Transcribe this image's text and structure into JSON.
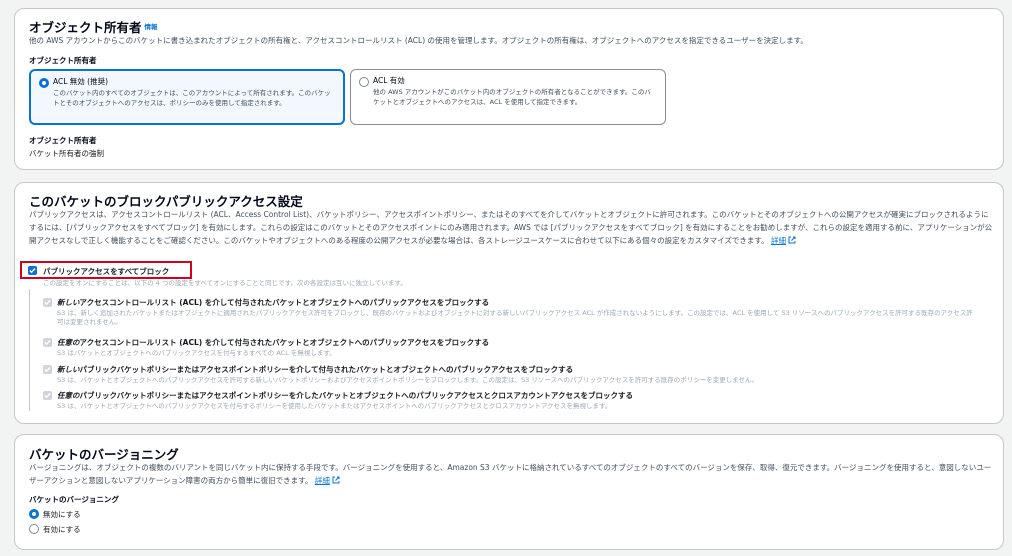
{
  "owner": {
    "title": "オブジェクト所有者",
    "info": "情報",
    "desc": "他の AWS アカウントからこのバケットに書き込まれたオブジェクトの所有権と、アクセスコントロールリスト (ACL) の使用を管理します。オブジェクトの所有権は、オブジェクトへのアクセスを指定できるユーザーを決定します。",
    "field_label": "オブジェクト所有者",
    "options": [
      {
        "title": "ACL 無効 (推奨)",
        "desc": "このバケット内のすべてのオブジェクトは、このアカウントによって所有されます。このバケットとそのオブジェクトへのアクセスは、ポリシーのみを使用して指定されます。"
      },
      {
        "title": "ACL 有効",
        "desc": "他の AWS アカウントがこのバケット内のオブジェクトの所有者となることができます。このバケットとオブジェクトへのアクセスは、ACL を使用して指定できます。"
      }
    ],
    "result_label": "オブジェクト所有者",
    "result_value": "バケット所有者の強制"
  },
  "block": {
    "title": "このバケットのブロックパブリックアクセス設定",
    "desc": "パブリックアクセスは、アクセスコントロールリスト (ACL、Access Control List)、バケットポリシー、アクセスポイントポリシー、またはそのすべてを介してバケットとオブジェクトに許可されます。このバケットとそのオブジェクトへの公開アクセスが確実にブロックされるようにするには、[パブリックアクセスをすべてブロック] を有効にします。これらの設定はこのバケットとそのアクセスポイントにのみ適用されます。AWS では [パブリックアクセスをすべてブロック] を有効にすることをお勧めしますが、これらの設定を適用する前に、アプリケーションが公開アクセスなしで正しく機能することをご確認ください。このバケットやオブジェクトへのある程度の公開アクセスが必要な場合は、各ストレージユースケースに合わせて以下にある個々の設定をカスタマイズできます。",
    "more_link": "詳細",
    "master_label": "パブリックアクセスをすべてブロック",
    "master_desc": "この設定をオンにすることは、以下の 4 つの設定をすべてオンにすることと同じです。次の各設定は互いに独立しています。",
    "items": [
      {
        "title_em": "新しい",
        "title_rest": "アクセスコントロールリスト (ACL) を介して付与されたバケットとオブジェクトへのパブリックアクセスをブロックする",
        "desc": "S3 は、新しく追加されたバケットまたはオブジェクトに適用されたパブリックアクセス許可をブロックし、既存のバケットおよびオブジェクトに対する新しいパブリックアクセス ACL が作成されないようにします。この設定では、ACL を使用して S3 リソースへのパブリックアクセスを許可する既存のアクセス許可は変更されません。"
      },
      {
        "title_em": "任意の",
        "title_rest": "アクセスコントロールリスト (ACL) を介して付与されたバケットとオブジェクトへのパブリックアクセスをブロックする",
        "desc": "S3 はバケットとオブジェクトへのパブリックアクセスを付与するすべての ACL を無視します。"
      },
      {
        "title_em": "新しい",
        "title_rest": "パブリックバケットポリシーまたはアクセスポイントポリシーを介して付与されたバケットとオブジェクトへのパブリックアクセスをブロックする",
        "desc": "S3 は、バケットとオブジェクトへのパブリックアクセスを許可する新しいバケットポリシーおよびアクセスポイントポリシーをブロックします。この設定は、S3 リソースへのパブリックアクセスを許可する既存のポリシーを変更しません。"
      },
      {
        "title_em": "任意の",
        "title_rest": "パブリックバケットポリシーまたはアクセスポイントポリシーを介したバケットとオブジェクトへのパブリックアクセスとクロスアカウントアクセスをブロックする",
        "desc": "S3 は、バケットとオブジェクトへのパブリックアクセスを付与するポリシーを使用したバケットまたはアクセスポイントへのパブリックアクセスとクロスアカウントアクセスを無視します。"
      }
    ]
  },
  "versioning": {
    "title": "バケットのバージョニング",
    "desc": "バージョニングは、オブジェクトの複数のバリアントを同じバケット内に保持する手段です。バージョニングを使用すると、Amazon S3 バケットに格納されているすべてのオブジェクトのすべてのバージョンを保存、取得、復元できます。バージョニングを使用すると、意図しないユーザーアクションと意図しないアプリケーション障害の両方から簡単に復旧できます。",
    "more_link": "詳細",
    "field_label": "バケットのバージョニング",
    "options": [
      "無効にする",
      "有効にする"
    ]
  },
  "colors": {
    "accent": "#0972d3",
    "highlight": "#d0021b"
  }
}
